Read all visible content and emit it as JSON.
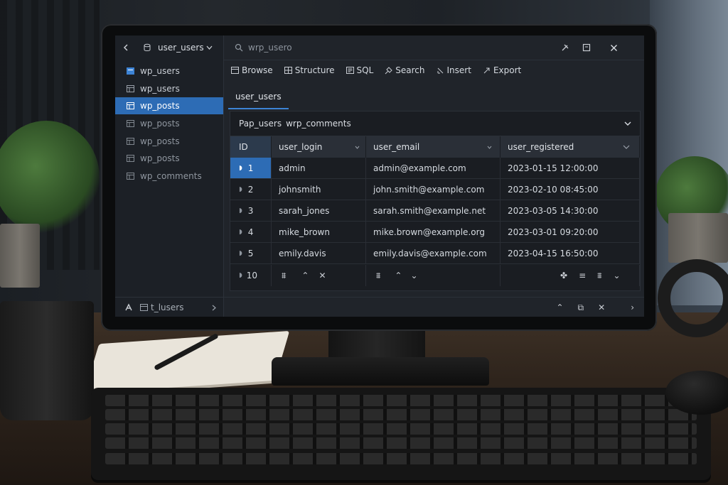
{
  "header": {
    "back_icon": "arrow-left-icon",
    "db_icon": "database-icon",
    "db_selector": "user_users",
    "search_placeholder": "wrp_usero",
    "window_icons": [
      "pin-icon",
      "maximize-icon",
      "close-icon"
    ]
  },
  "sidebar": {
    "items": [
      {
        "label": "wp_users",
        "icon": "table-blue-icon",
        "state": "header"
      },
      {
        "label": "wp_users",
        "icon": "table-icon",
        "state": "normal"
      },
      {
        "label": "wp_posts",
        "icon": "table-icon",
        "state": "active"
      },
      {
        "label": "wp_posts",
        "icon": "table-icon",
        "state": "dim"
      },
      {
        "label": "wp_posts",
        "icon": "table-icon",
        "state": "dim"
      },
      {
        "label": "wp_posts",
        "icon": "table-icon",
        "state": "dim"
      },
      {
        "label": "wp_comments",
        "icon": "table-icon",
        "state": "dim"
      }
    ],
    "bottom_label": "t_lusers"
  },
  "toolbar": {
    "items": [
      {
        "label": "Browse",
        "icon": "browse-icon"
      },
      {
        "label": "Structure",
        "icon": "structure-icon"
      },
      {
        "label": "SQL",
        "icon": "sql-icon"
      },
      {
        "label": "Search",
        "icon": "search-icon"
      },
      {
        "label": "Insert",
        "icon": "insert-icon"
      },
      {
        "label": "Export",
        "icon": "export-icon"
      }
    ]
  },
  "tab": {
    "label": "user_users"
  },
  "filter": {
    "label": "Pap_users",
    "value": "wrp_comments"
  },
  "table": {
    "columns": [
      "ID",
      "user_login",
      "user_email",
      "user_registered"
    ],
    "rows": [
      {
        "id": "1",
        "login": "admin",
        "email": "admin@example.com",
        "registered": "2023-01-15 12:00:00"
      },
      {
        "id": "2",
        "login": "johnsmith",
        "email": "john.smith@example.com",
        "registered": "2023-02-10 08:45:00"
      },
      {
        "id": "3",
        "login": "sarah_jones",
        "email": "sarah.smith@example.net",
        "registered": "2023-03-05 14:30:00"
      },
      {
        "id": "4",
        "login": "mike_brown",
        "email": "mike.brown@example.org",
        "registered": "2023-03-01 09:20:00"
      },
      {
        "id": "5",
        "login": "emily.davis",
        "email": "emily.davis@example.com",
        "registered": "2023-04-15 16:50:00"
      }
    ],
    "pager_value": "10"
  },
  "colors": {
    "accent": "#2d6cb5",
    "panel": "#1a1d22",
    "header_row": "#2a2f37"
  }
}
